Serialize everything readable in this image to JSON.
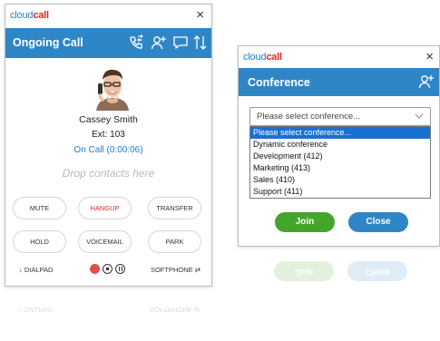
{
  "call_window": {
    "logo": {
      "part1": "cloud",
      "part2": "call"
    },
    "close_glyph": "×",
    "title": "Ongoing Call",
    "contact": {
      "name": "Cassey Smith",
      "ext": "Ext: 103",
      "status": "On Call (0:00:06)"
    },
    "drop_hint": "Drop contacts here",
    "buttons": {
      "mute": "MUTE",
      "hangup": "HANGUP",
      "transfer": "TRANSFER",
      "hold": "HOLD",
      "voicemail": "VOICEMAIL",
      "park": "PARK"
    },
    "bottom": {
      "dialpad": "↓ DIALPAD",
      "softphone": "SOFTPHONE ⇄"
    },
    "colors": {
      "accent": "#2f86c7",
      "hangup": "#e1261c",
      "status": "#1a7fd6"
    }
  },
  "conference_window": {
    "logo": {
      "part1": "cloud",
      "part2": "call"
    },
    "close_glyph": "×",
    "title": "Conference",
    "select": {
      "value": "Please select conference..."
    },
    "options": [
      "Please select conference...",
      "Dynamic conference",
      "Development (412)",
      "Marketing (413)",
      "Sales (410)",
      "Support (411)"
    ],
    "join_label": "Join",
    "close_label": "Close",
    "colors": {
      "join": "#43a52c",
      "close": "#2f86c7",
      "selected_option": "#1a6fd4"
    }
  }
}
